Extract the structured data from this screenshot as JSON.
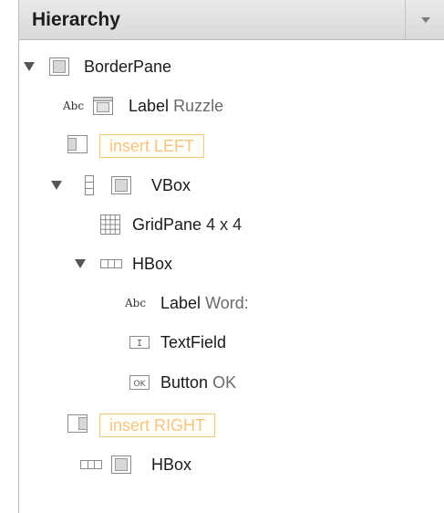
{
  "panel": {
    "title": "Hierarchy"
  },
  "tree": [
    {
      "id": "borderpane",
      "icon": "border-pane-icon",
      "type": "BorderPane",
      "value": ""
    },
    {
      "id": "label-ruzzle",
      "icon": "label-abc-icon",
      "type": "Label",
      "value": "Ruzzle"
    },
    {
      "id": "insert-left",
      "icon": "border-pane-icon",
      "type": "insert LEFT",
      "value": ""
    },
    {
      "id": "vbox",
      "icon": "vbox-icon",
      "type": "VBox",
      "value": ""
    },
    {
      "id": "gridpane",
      "icon": "grid-pane-icon",
      "type": "GridPane",
      "value": "4 x 4"
    },
    {
      "id": "hbox-inner",
      "icon": "hbox-icon",
      "type": "HBox",
      "value": ""
    },
    {
      "id": "label-word",
      "icon": "label-abc-icon",
      "type": "Label",
      "value": "Word:"
    },
    {
      "id": "textfield",
      "icon": "text-field-icon",
      "type": "TextField",
      "value": ""
    },
    {
      "id": "button-ok",
      "icon": "button-ok-icon",
      "type": "Button",
      "value": "OK"
    },
    {
      "id": "insert-right",
      "icon": "border-pane-icon",
      "type": "insert RIGHT",
      "value": ""
    },
    {
      "id": "hbox-outer",
      "icon": "hbox-icon",
      "type": "HBox",
      "value": ""
    }
  ],
  "glyphs": {
    "abc": "Abc",
    "ok": "OK",
    "text_cursor": "I"
  },
  "colors": {
    "header_bg": "#dedede",
    "insert_border": "#f2c97c",
    "insert_text": "#f3c581",
    "value_text": "#6a6a6a"
  }
}
